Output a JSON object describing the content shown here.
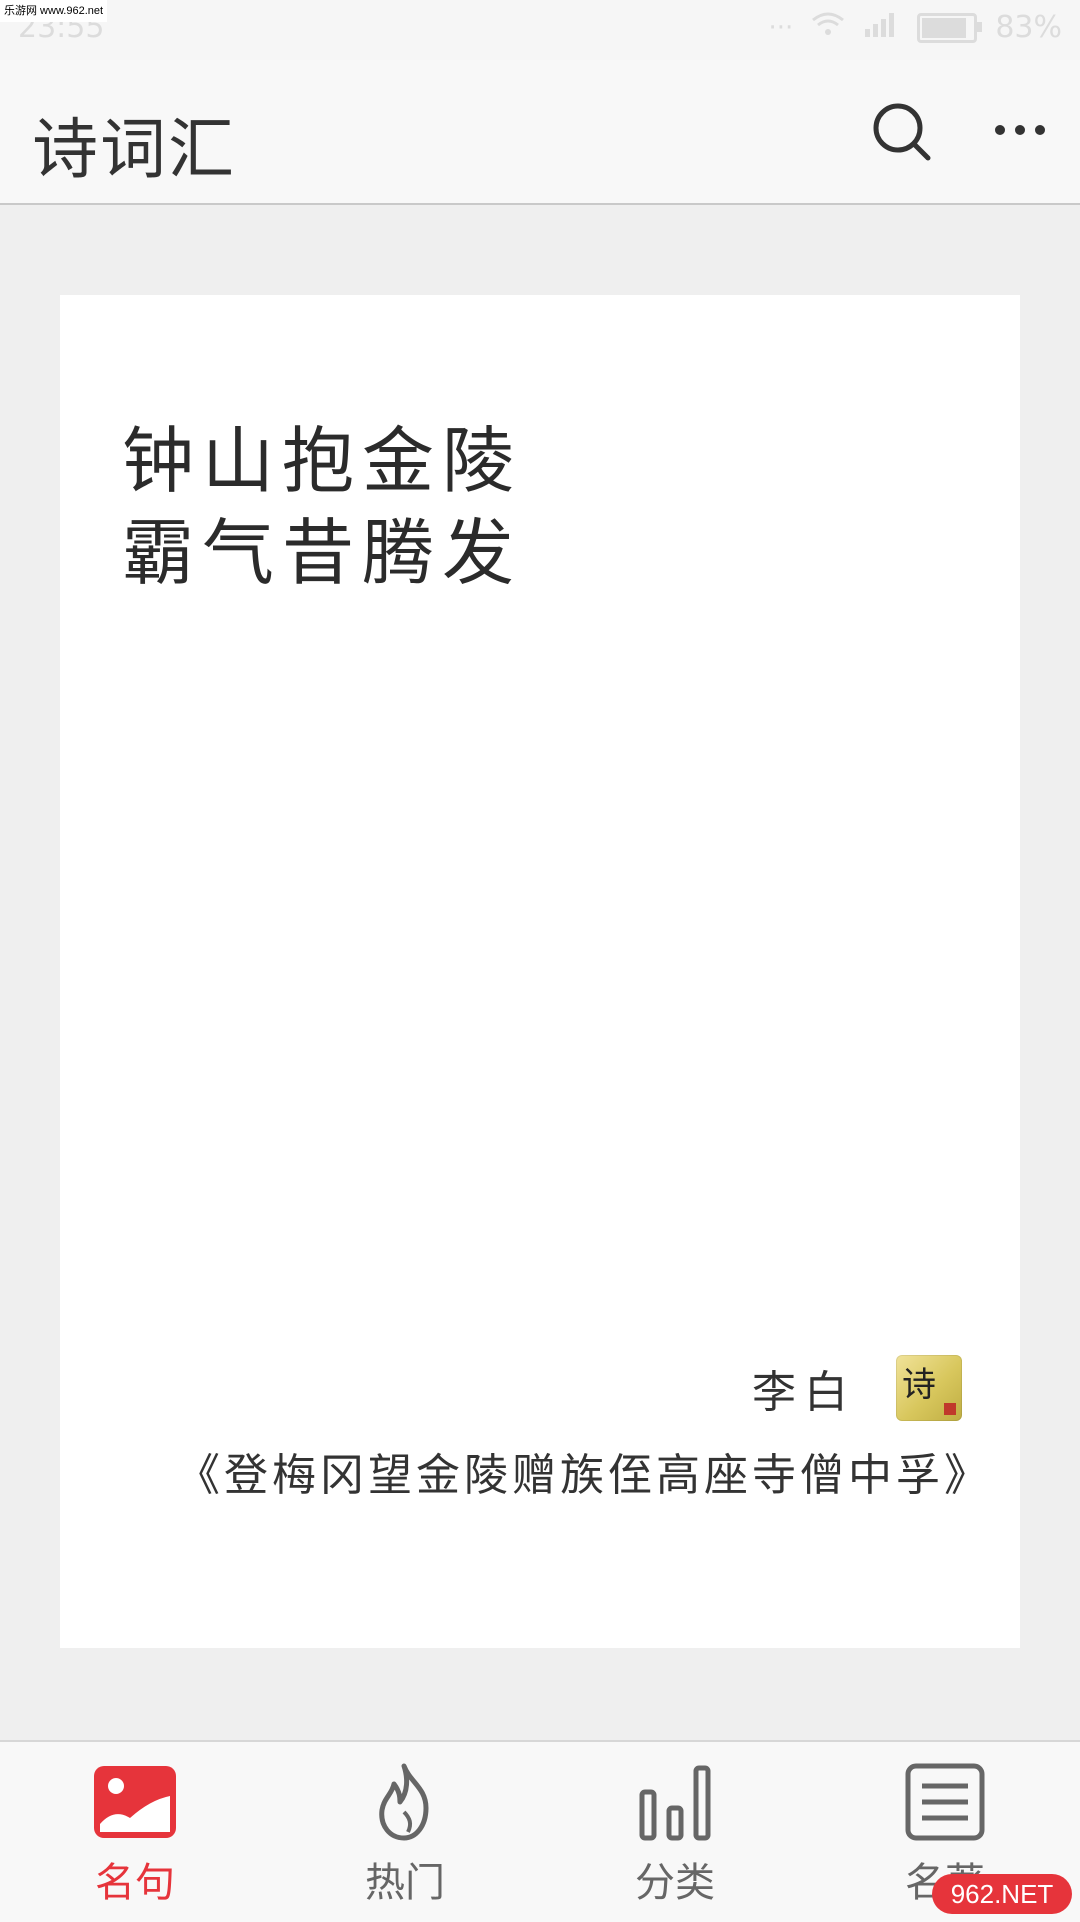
{
  "watermark": {
    "top_left": "乐游网 www.962.net",
    "bottom_right": "962.NET"
  },
  "status_bar": {
    "time": "23:55",
    "battery": "83%"
  },
  "app_bar": {
    "title": "诗词汇"
  },
  "card": {
    "quote_lines": [
      "钟山抱金陵",
      "霸气昔腾发"
    ],
    "author": "李白",
    "source": "《登梅冈望金陵赠族侄高座寺僧中孚》",
    "seal_char": "诗"
  },
  "bottom_nav": {
    "items": [
      {
        "label": "名句",
        "icon": "image-icon",
        "active": true
      },
      {
        "label": "热门",
        "icon": "flame-icon",
        "active": false
      },
      {
        "label": "分类",
        "icon": "bar-chart-icon",
        "active": false
      },
      {
        "label": "名著",
        "icon": "document-icon",
        "active": false
      }
    ]
  },
  "colors": {
    "accent": "#e6343b",
    "background": "#efefef",
    "card": "#ffffff"
  }
}
